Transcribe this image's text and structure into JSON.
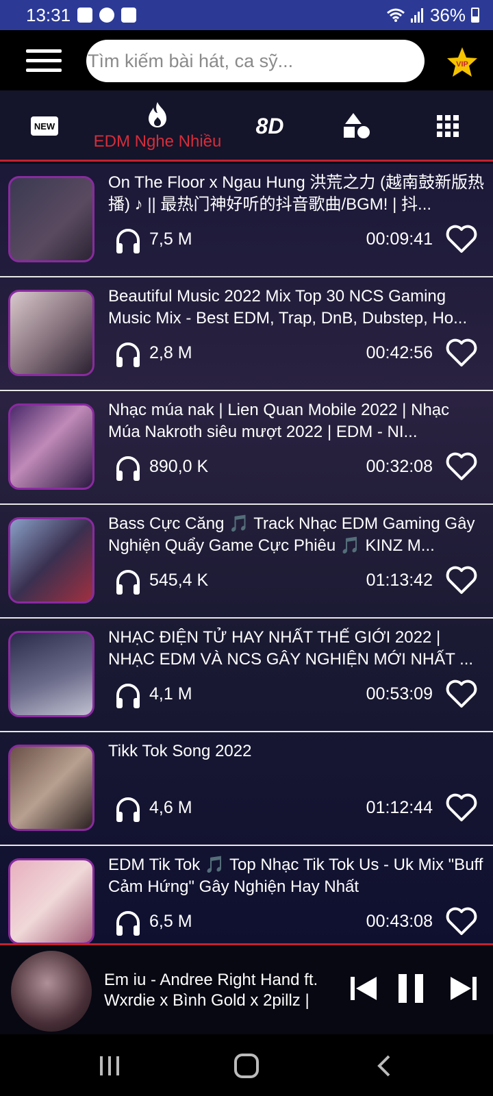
{
  "status_bar": {
    "time": "13:31",
    "battery": "36%",
    "colors": {
      "background": "#2c3a96"
    }
  },
  "search": {
    "placeholder": "Tìm kiếm bài hát, ca sỹ..."
  },
  "vip": {
    "label": "VIP",
    "icon": "star-icon"
  },
  "tabs": [
    {
      "icon": "new-badge-icon",
      "label": "NEW"
    },
    {
      "icon": "fire-icon",
      "label": "EDM Nghe Nhiều",
      "active": true
    },
    {
      "icon": "8d-icon",
      "label": "8D"
    },
    {
      "icon": "shapes-icon"
    },
    {
      "icon": "grid-icon"
    }
  ],
  "accent_color": "#c4222e",
  "songs": [
    {
      "title": "On The Floor x Ngau Hung 洪荒之力 (越南鼓新版热播) ♪ || 最热门神好听的抖音歌曲/BGM! | 抖...",
      "plays": "7,5 M",
      "duration": "00:09:41"
    },
    {
      "title": "Beautiful Music 2022 Mix Top 30 NCS Gaming Music Mix - Best EDM, Trap, DnB, Dubstep, Ho...",
      "plays": "2,8 M",
      "duration": "00:42:56"
    },
    {
      "title": "Nhạc múa nak | Lien Quan Mobile 2022 | Nhạc Múa Nakroth siêu mượt 2022 | EDM - NI...",
      "plays": "890,0 K",
      "duration": "00:32:08"
    },
    {
      "title": "Bass Cực Căng 🎵 Track Nhạc EDM Gaming Gây Nghiện Quẩy Game Cực Phiêu 🎵 KINZ M...",
      "plays": "545,4 K",
      "duration": "01:13:42"
    },
    {
      "title": "NHẠC ĐIỆN TỬ HAY NHẤT THẾ GIỚI 2022 | NHẠC EDM VÀ NCS GÂY NGHIỆN MỚI NHẤT ...",
      "plays": "4,1 M",
      "duration": "00:53:09"
    },
    {
      "title": "Tikk Tok Song 2022",
      "plays": "4,6 M",
      "duration": "01:12:44"
    },
    {
      "title": "EDM Tik Tok 🎵 Top Nhạc Tik Tok Us - Uk Mix \"Buff Cảm Hứng\" Gây Nghiện Hay Nhất",
      "plays": "6,5 M",
      "duration": "00:43:08"
    }
  ],
  "player": {
    "title": "Em iu - Andree Right Hand ft. Wxrdie x Bình Gold x 2pillz |"
  }
}
